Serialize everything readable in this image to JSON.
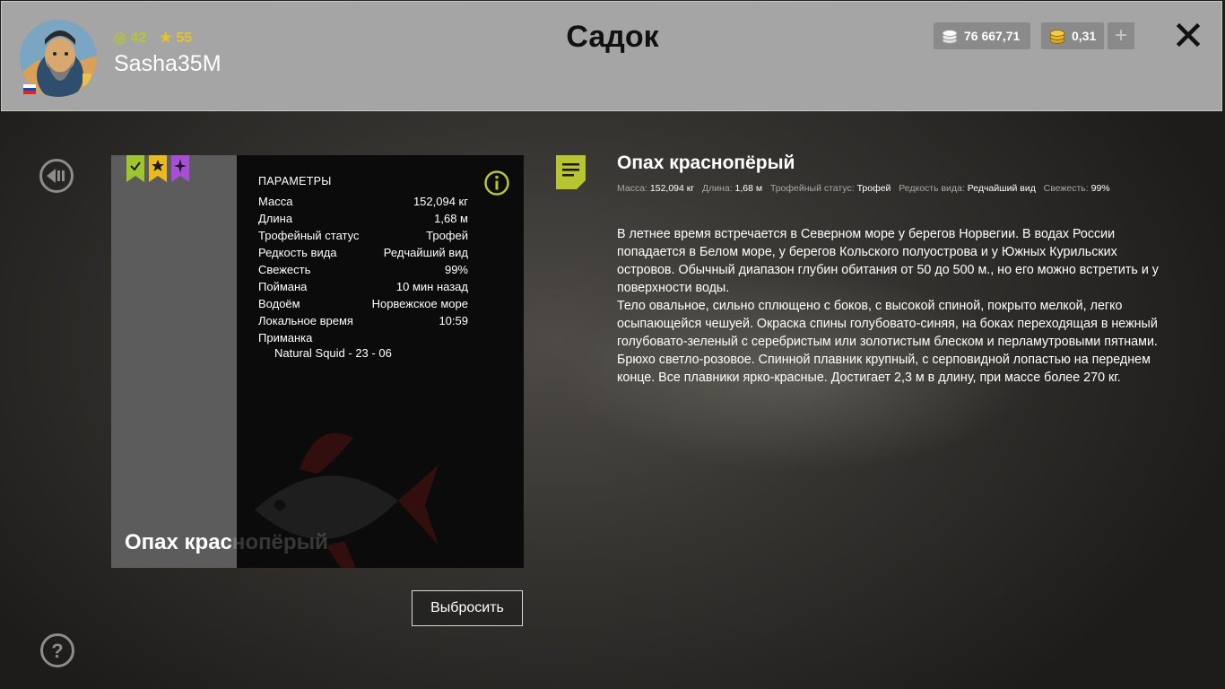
{
  "header": {
    "username": "Sasha35M",
    "level": "42",
    "rank": "55",
    "title": "Садок",
    "silver": "76 667,71",
    "gold": "0,31",
    "plus_label": "+"
  },
  "card": {
    "params_title": "ПАРАМЕТРЫ",
    "params": [
      {
        "label": "Масса",
        "value": "152,094 кг"
      },
      {
        "label": "Длина",
        "value": "1,68 м"
      },
      {
        "label": "Трофейный статус",
        "value": "Трофей"
      },
      {
        "label": "Редкость вида",
        "value": "Редчайший вид"
      },
      {
        "label": "Свежесть",
        "value": "99%"
      },
      {
        "label": "Поймана",
        "value": "10 мин назад"
      },
      {
        "label": "Водоём",
        "value": "Норвежское море"
      },
      {
        "label": "Локальное время",
        "value": "10:59"
      }
    ],
    "bait_label": "Приманка",
    "bait_value": "Natural Squid - 23 - 06",
    "fish_name_visible": "Опах крас",
    "fish_name_faded": "нопёрый",
    "discard_label": "Выбросить"
  },
  "info": {
    "title": "Опах краснопёрый",
    "summary": [
      {
        "label": "Масса:",
        "value": "152,094 кг"
      },
      {
        "label": "Длина:",
        "value": "1,68 м"
      },
      {
        "label": "Трофейный статус:",
        "value": "Трофей"
      },
      {
        "label": "Редкость вида:",
        "value": "Редчайший вид"
      },
      {
        "label": "Свежесть:",
        "value": "99%"
      }
    ],
    "description_1": "В летнее время встречается в Северном море у берегов Норвегии. В водах России попадается в Белом море, у берегов Кольского полуострова и у Южных Курильских островов. Обычный диапазон глубин обитания от 50 до 500 м., но его можно встретить и у поверхности воды.",
    "description_2": "Тело овальное, сильно сплющено с боков, с высокой спиной, покрыто мелкой, легко осыпающейся чешуей. Окраска спины голубовато-синяя, на боках переходящая в нежный голубовато-зеленый с серебристым или золотистым блеском и перламутровыми пятнами. Брюхо светло-розовое. Спинной плавник крупный, с серповидной лопастью на переднем конце. Все плавники ярко-красные. Достигает 2,3 м в длину, при массе более 270 кг."
  },
  "colors": {
    "accent_green": "#b9c431",
    "ribbon_green": "#9fc52f",
    "ribbon_gold": "#e9b91f",
    "ribbon_purple": "#a64fd6",
    "header_bg": "#a5a5a5"
  },
  "icons": [
    "avatar",
    "russia-flag-icon",
    "level-icon",
    "star-icon",
    "silver-coins-icon",
    "gold-coins-icon",
    "plus-icon",
    "close-icon",
    "back-arrow-icon",
    "help-icon",
    "info-icon",
    "document-icon",
    "check-ribbon-icon",
    "star-ribbon-icon",
    "sparkle-ribbon-icon"
  ]
}
